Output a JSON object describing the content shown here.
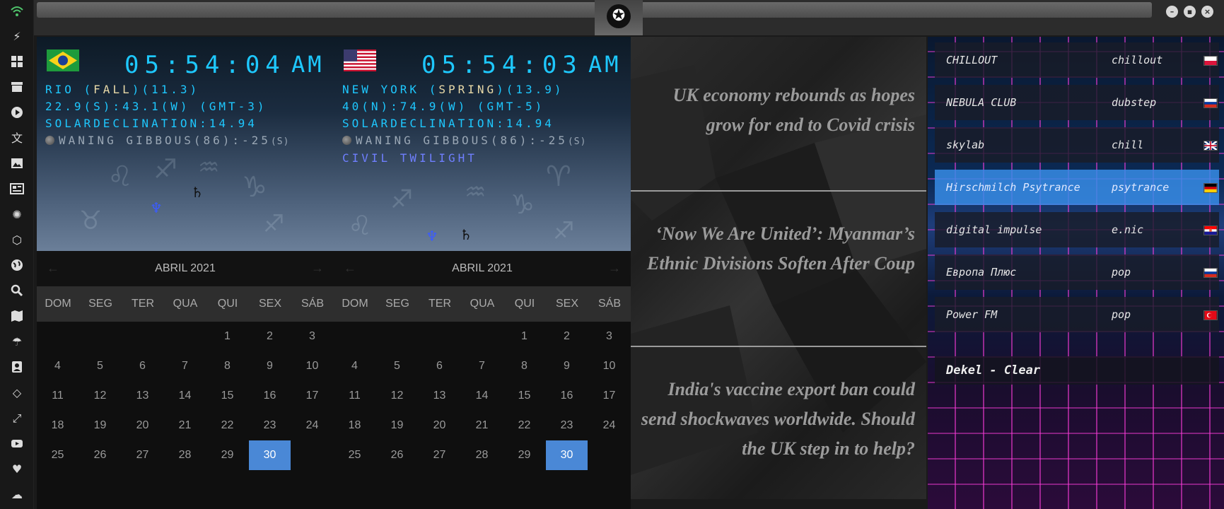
{
  "sidebar": {
    "icons": [
      "wifi-icon",
      "lightning-icon",
      "windows-icon",
      "archive-icon",
      "play-icon",
      "translate-icon",
      "image-icon",
      "news-icon",
      "settings-icon",
      "hexagon-icon",
      "globe-icon",
      "search-icon",
      "map-icon",
      "umbrella-icon",
      "contacts-icon",
      "code-icon",
      "fullscreen-icon",
      "youtube-icon",
      "heart-icon",
      "cloud-icon"
    ]
  },
  "window": {
    "controls": [
      "minimize",
      "maximize",
      "close"
    ]
  },
  "clocks": [
    {
      "time": "05:54:04",
      "ampm": "AM",
      "city": "RIO",
      "season": "FALL",
      "temp": "11.3",
      "coords": "22.9(S):43.1(W) (GMT-3)",
      "declination": "SOLARDECLINATION:14.94",
      "moon": "WANING GIBBOUS(86):-25",
      "moon_suffix": "(S)",
      "twilight": "",
      "calendar": {
        "month": "ABRIL 2021",
        "days": [
          "DOM",
          "SEG",
          "TER",
          "QUA",
          "QUI",
          "SEX",
          "SÁB"
        ],
        "first_weekday": 4,
        "num_days": 30,
        "today": 30
      }
    },
    {
      "time": "05:54:03",
      "ampm": "AM",
      "city": "NEW YORK",
      "season": "SPRING",
      "temp": "13.9",
      "coords": "40(N):74.9(W) (GMT-5)",
      "declination": "SOLARDECLINATION:14.94",
      "moon": "WANING GIBBOUS(86):-25",
      "moon_suffix": "(S)",
      "twilight": "CIVIL TWILIGHT",
      "calendar": {
        "month": "ABRIL 2021",
        "days": [
          "DOM",
          "SEG",
          "TER",
          "QUA",
          "QUI",
          "SEX",
          "SÁB"
        ],
        "first_weekday": 4,
        "num_days": 30,
        "today": 30
      }
    }
  ],
  "news": [
    "UK economy rebounds as hopes grow for end to Covid crisis",
    "‘Now We Are United’: Myanmar’s Ethnic Divisions Soften After Coup",
    "India's vaccine export ban could send shockwaves worldwide. Should the UK step in to help?"
  ],
  "radio": {
    "stations": [
      {
        "name": "CHILLOUT",
        "genre": "chillout",
        "flag": "poland"
      },
      {
        "name": "NEBULA CLUB",
        "genre": "dubstep",
        "flag": "russia"
      },
      {
        "name": "skylab",
        "genre": "chill",
        "flag": "uk"
      },
      {
        "name": "Hirschmilch Psytrance",
        "genre": "psytrance",
        "flag": "germany"
      },
      {
        "name": "digital impulse",
        "genre": "e.nic",
        "flag": "croatia"
      },
      {
        "name": "Европа Плюс",
        "genre": "pop",
        "flag": "russia"
      },
      {
        "name": "Power FM",
        "genre": "pop",
        "flag": "turkey"
      }
    ],
    "now_playing": "Dekel - Clear"
  }
}
